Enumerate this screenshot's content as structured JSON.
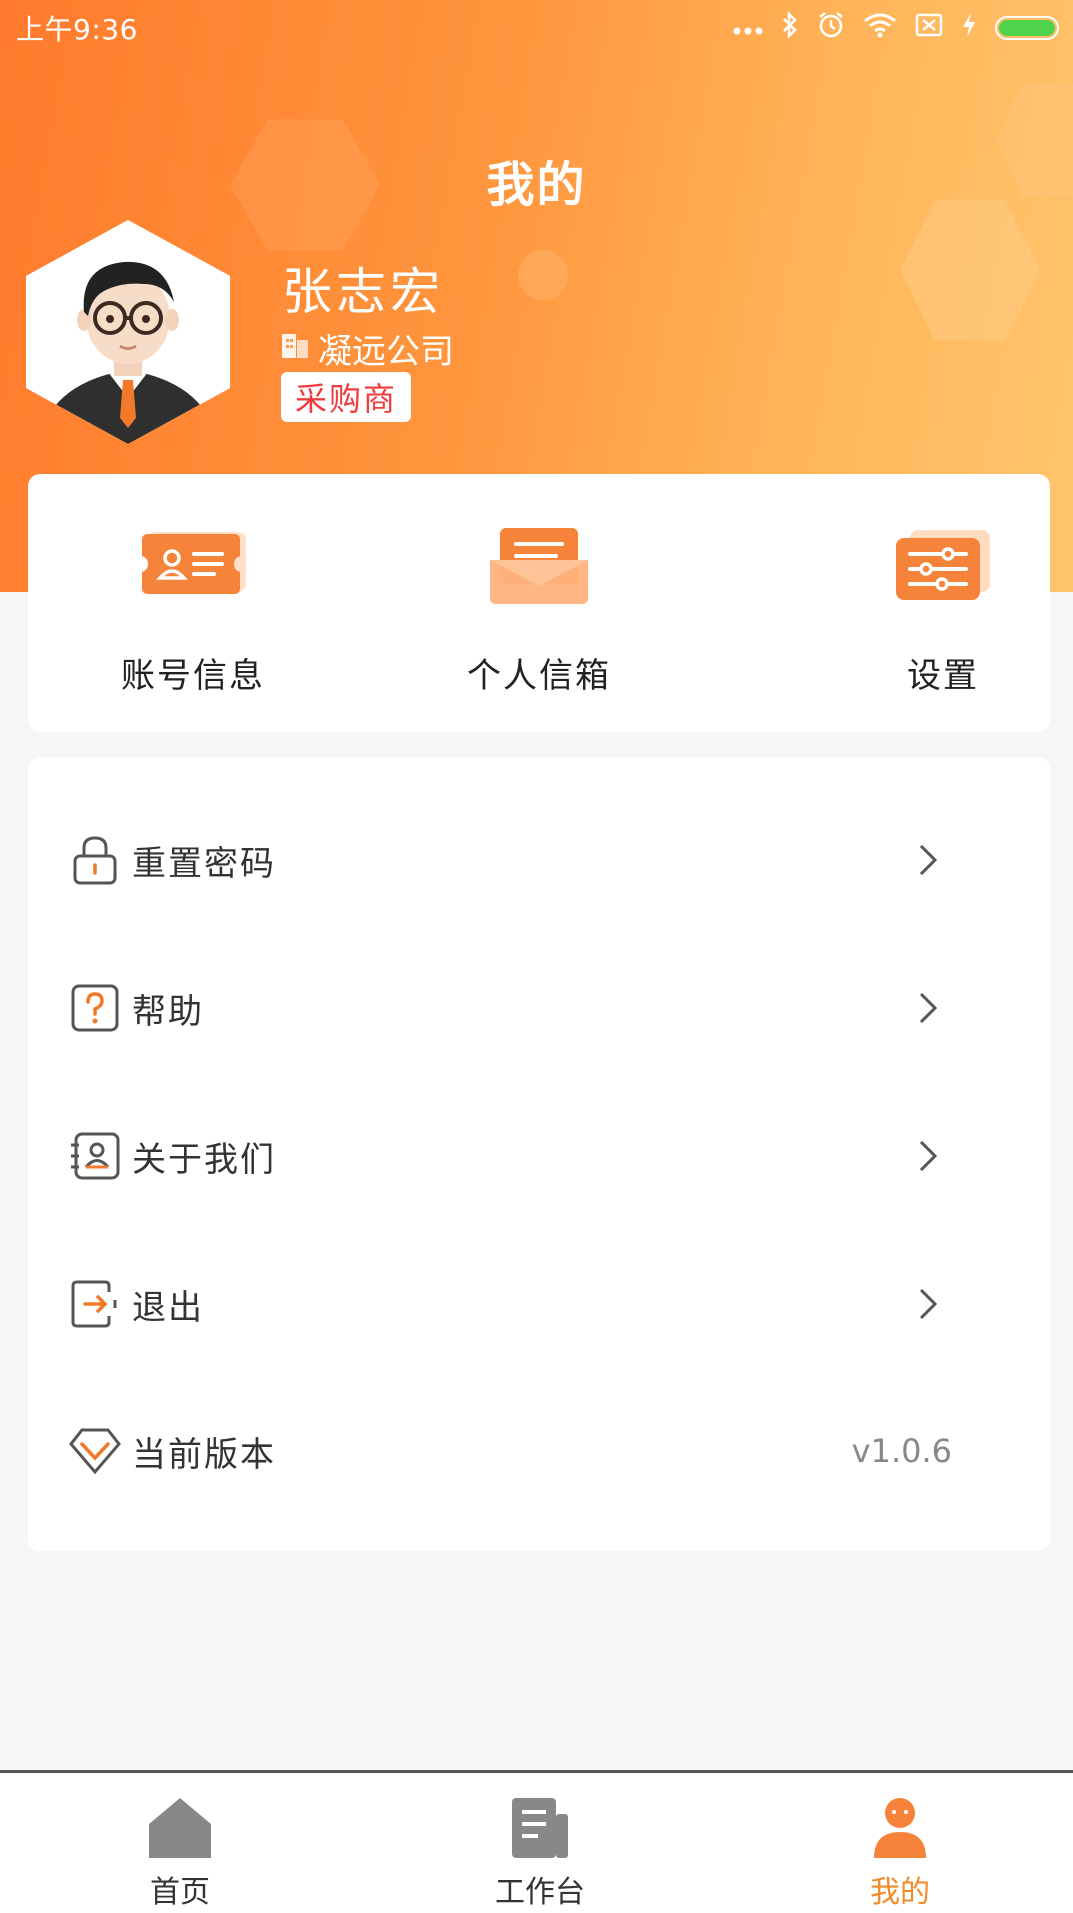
{
  "status_bar": {
    "time": "上午9:36",
    "icons": [
      "more-dots-icon",
      "bluetooth-icon",
      "alarm-icon",
      "wifi-icon",
      "sim-icon",
      "charging-icon",
      "battery-icon"
    ]
  },
  "header": {
    "title": "我的"
  },
  "profile": {
    "name": "张志宏",
    "company": "凝远公司",
    "role": "采购商"
  },
  "quick_actions": [
    {
      "label": "账号信息",
      "icon": "account-card-icon"
    },
    {
      "label": "个人信箱",
      "icon": "mailbox-icon"
    },
    {
      "label": "设置",
      "icon": "settings-sliders-icon"
    }
  ],
  "menu": [
    {
      "label": "重置密码",
      "icon": "lock-icon"
    },
    {
      "label": "帮助",
      "icon": "help-icon"
    },
    {
      "label": "关于我们",
      "icon": "about-contact-icon"
    },
    {
      "label": "退出",
      "icon": "logout-icon"
    },
    {
      "label": "当前版本",
      "icon": "version-diamond-icon",
      "value": "v1.0.6"
    }
  ],
  "tab_bar": [
    {
      "label": "首页",
      "icon": "home-icon",
      "active": false
    },
    {
      "label": "工作台",
      "icon": "workbench-icon",
      "active": false
    },
    {
      "label": "我的",
      "icon": "profile-icon",
      "active": true
    }
  ],
  "colors": {
    "accent": "#f28a2a",
    "gradient_start": "#ff7a2c",
    "gradient_end": "#ffc56d",
    "badge_text": "#ef3b3b"
  }
}
